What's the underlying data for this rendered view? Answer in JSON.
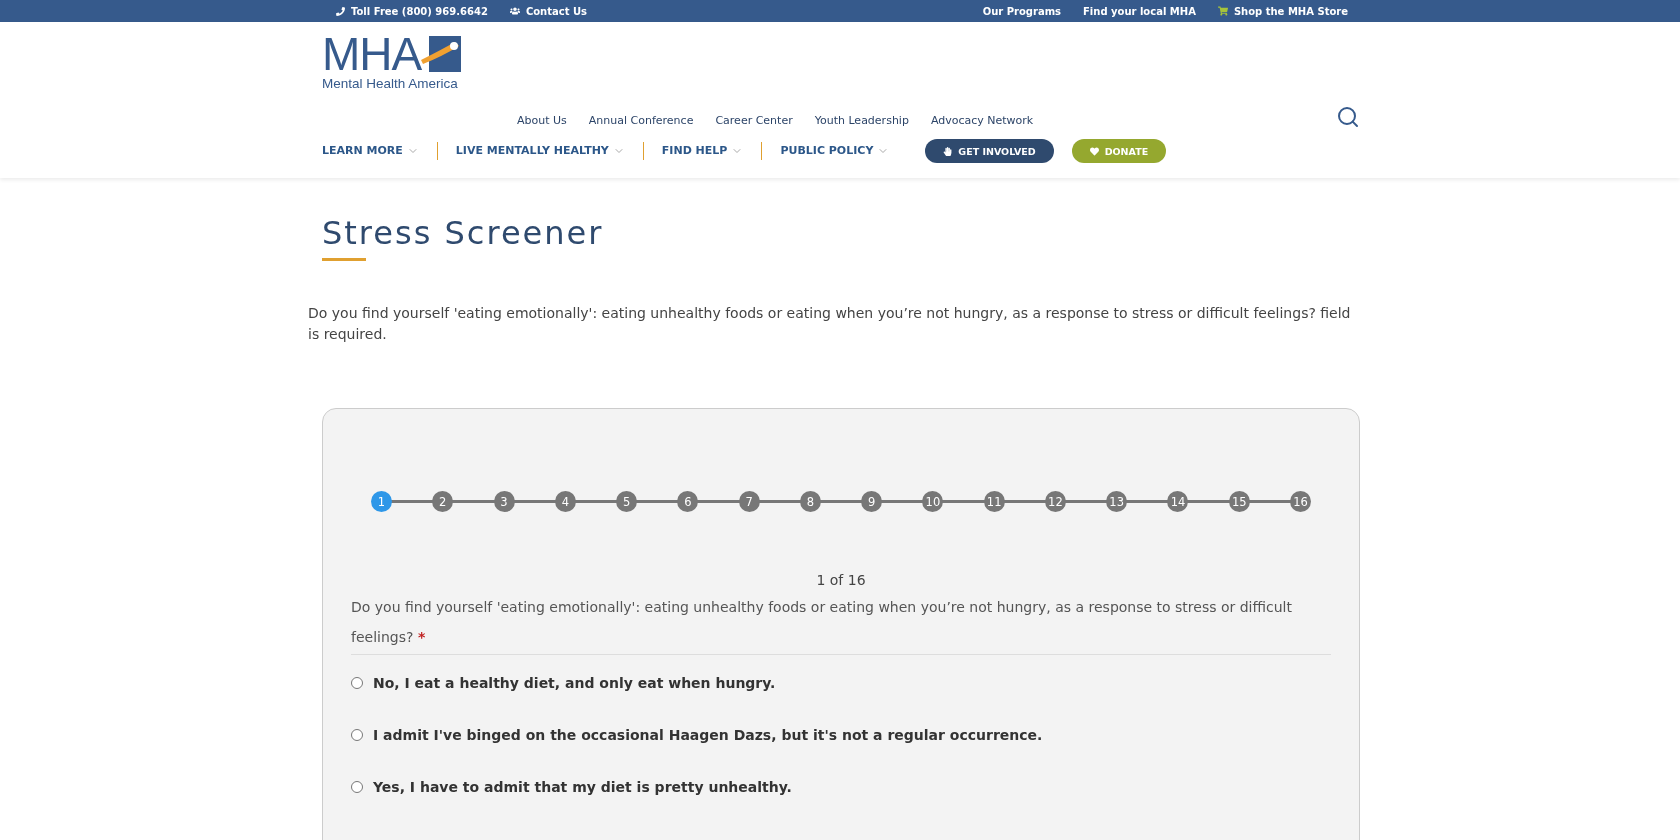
{
  "top_bar": {
    "left": [
      {
        "kind": "phone",
        "label": "Toll Free (800) 969.6642"
      },
      {
        "kind": "people",
        "label": "Contact Us"
      }
    ],
    "right": [
      {
        "kind": "plain",
        "label": "Our Programs"
      },
      {
        "kind": "plain",
        "label": "Find your local MHA"
      },
      {
        "kind": "cart",
        "label": "Shop the MHA Store"
      }
    ]
  },
  "logo": {
    "mark": "MHA",
    "name": "Mental Health America"
  },
  "secondary_nav": [
    "About Us",
    "Annual Conference",
    "Career Center",
    "Youth Leadership",
    "Advocacy Network"
  ],
  "main_nav": [
    {
      "label": "LEARN MORE"
    },
    {
      "label": "LIVE MENTALLY HEALTHY"
    },
    {
      "label": "FIND HELP"
    },
    {
      "label": "PUBLIC POLICY"
    }
  ],
  "actions": [
    {
      "kind": "hand",
      "label": "GET INVOLVED",
      "color": "#2f4a6e"
    },
    {
      "kind": "heart",
      "label": "DONATE",
      "color": "#95a82f"
    }
  ],
  "page_title": "Stress Screener",
  "error_message": "Do you find yourself 'eating emotionally': eating unhealthy foods or eating when you’re not hungry, as a response to stress or difficult feelings? field is required.",
  "steps": [
    {
      "label": "1",
      "selected": true
    },
    {
      "label": "2",
      "selected": false
    },
    {
      "label": "3",
      "selected": false
    },
    {
      "label": "4",
      "selected": false
    },
    {
      "label": "5",
      "selected": false
    },
    {
      "label": "6",
      "selected": false
    },
    {
      "label": "7",
      "selected": false
    },
    {
      "label": "8",
      "selected": false
    },
    {
      "label": "9",
      "selected": false
    },
    {
      "label": "10",
      "selected": false
    },
    {
      "label": "11",
      "selected": false
    },
    {
      "label": "12",
      "selected": false
    },
    {
      "label": "13",
      "selected": false
    },
    {
      "label": "14",
      "selected": false
    },
    {
      "label": "15",
      "selected": false
    },
    {
      "label": "16",
      "selected": false
    }
  ],
  "progress": "1 of 16",
  "question": {
    "text": "Do you find yourself 'eating emotionally': eating unhealthy foods or eating when you’re not hungry, as a response to stress or difficult feelings?",
    "required_mark": "*"
  },
  "options": [
    {
      "label": "No, I eat a healthy diet, and only eat when hungry.",
      "selected": false
    },
    {
      "label": "I admit I've binged on the occasional Haagen Dazs, but it's not a regular occurrence.",
      "selected": false
    },
    {
      "label": "Yes, I have to admit that my diet is pretty unhealthy.",
      "selected": false
    }
  ]
}
